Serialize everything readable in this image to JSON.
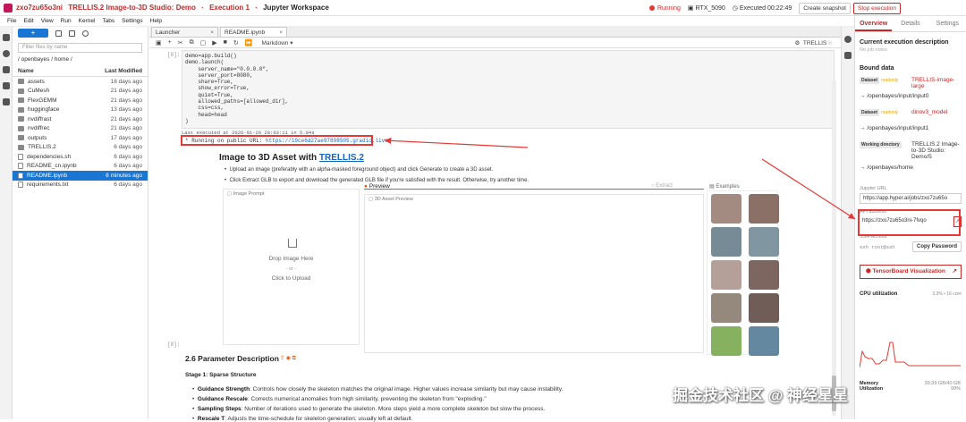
{
  "topbar": {
    "id": "zxo7zu65o3ni",
    "title": "TRELLIS.2 Image-to-3D Studio: Demo",
    "execution": "Execution 1",
    "workspace": "Jupyter Workspace",
    "status": "Running",
    "gpu": "RTX_5090",
    "executed_label": "Executed",
    "executed_time": "00:22:49",
    "create_snapshot": "Create snapshot",
    "stop_execution": "Stop execution"
  },
  "menu": [
    "File",
    "Edit",
    "View",
    "Run",
    "Kernel",
    "Tabs",
    "Settings",
    "Help"
  ],
  "filebrowser": {
    "new": "+",
    "filter_placeholder": "Filter files by name",
    "path": "/ openbayes / home /",
    "col_name": "Name",
    "col_modified": "Last Modified",
    "files": [
      {
        "name": "assets",
        "mod": "18 days ago",
        "type": "folder"
      },
      {
        "name": "CuMesh",
        "mod": "21 days ago",
        "type": "folder"
      },
      {
        "name": "FlexGEMM",
        "mod": "21 days ago",
        "type": "folder"
      },
      {
        "name": "huggingface",
        "mod": "13 days ago",
        "type": "folder"
      },
      {
        "name": "nvdiffrast",
        "mod": "21 days ago",
        "type": "folder"
      },
      {
        "name": "nvdiffrec",
        "mod": "21 days ago",
        "type": "folder"
      },
      {
        "name": "outputs",
        "mod": "17 days ago",
        "type": "folder"
      },
      {
        "name": "TRELLIS.2",
        "mod": "6 days ago",
        "type": "folder"
      },
      {
        "name": "dependencies.sh",
        "mod": "6 days ago",
        "type": "file"
      },
      {
        "name": "README_cn.ipynb",
        "mod": "6 days ago",
        "type": "file"
      },
      {
        "name": "README.ipynb",
        "mod": "8 minutes ago",
        "type": "file",
        "selected": true
      },
      {
        "name": "requirements.txt",
        "mod": "6 days ago",
        "type": "file"
      }
    ]
  },
  "tabs": [
    {
      "label": "Launcher"
    },
    {
      "label": "README.ipynb"
    }
  ],
  "notebook": {
    "cell_type": "Markdown",
    "kernel": "TRELLIS",
    "prompt1": "[8]:",
    "code_lines": [
      "demo=app.build()",
      "demo.launch(",
      "    server_name=\"0.0.0.0\",",
      "    server_port=8080,",
      "    share=True,",
      "    show_error=True,",
      "    quiet=True,",
      "    allowed_paths=[allowed_dir],",
      "    css=css,",
      "    head=head",
      ")"
    ],
    "last_exec": "Last executed at 2026-01-26 20:03:11 in 5.94s",
    "running": "* Running on public URL: ",
    "public_url": "https://19ce6d27ae97898505.gradio.live",
    "gradio_title": "Image to 3D Asset with ",
    "gradio_link": "TRELLIS.2",
    "bullet1": "Upload an image (preferably with an alpha-masked foreground object) and click Generate to create a 3D asset.",
    "bullet2": "Click Extract GLB to export and download the generated GLB file if you're satisfied with the result. Otherwise, try another time.",
    "image_prompt": "Image Prompt",
    "preview": "Preview",
    "extract": "Extract",
    "asset_preview": "3D Asset Preview",
    "examples": "Examples",
    "drop": "Drop Image Here",
    "or": "- or -",
    "click_upload": "Click to Upload",
    "prompt2": "[8]:",
    "md_title": "2.6 Parameter Description",
    "md_stage": "Stage 1: Sparse Structure",
    "md_items": [
      {
        "k": "Guidance Strength",
        "v": ": Controls how closely the skeleton matches the original image. Higher values increase similarity but may cause instability."
      },
      {
        "k": "Guidance Rescale",
        "v": ": Corrects numerical anomalies from high similarity, preventing the skeleton from \"exploding.\""
      },
      {
        "k": "Sampling Steps",
        "v": ": Number of iterations used to generate the skeleton. More steps yield a more complete skeleton but slow the process."
      },
      {
        "k": "Rescale T",
        "v": ": Adjusts the time-schedule for skeleton generation; usually left at default."
      }
    ]
  },
  "right": {
    "tabs": [
      "Overview",
      "Details",
      "Settings"
    ],
    "current_desc": "Current execution description",
    "no_notes": "No job notes",
    "bound": "Bound data",
    "datasets": [
      {
        "tag": "Dataset",
        "ro": "readonly",
        "name": "TRELLIS-image-large",
        "path": "/openbayes/input/input0"
      },
      {
        "tag": "Dataset",
        "ro": "readonly",
        "name": "dinov3_model",
        "path": "/openbayes/input/input1"
      },
      {
        "tag": "Working directory",
        "ro": "",
        "name": "TRELLIS.2 Image-to-3D Studio: Demo/5",
        "path": "/openbayes/home"
      }
    ],
    "jupyter_url_label": "Jupyter URL",
    "jupyter_url": "https://app.hyper.ai/jobs/zxo7zu65o",
    "api_label": "API address",
    "api": "https://zxo7zu65o3ni-7fvqo",
    "ssh_label": "SSH Access",
    "ssh": "ssh root@ssh",
    "copy_pw": "Copy Password",
    "tensorboard": "TensorBoard Visualization",
    "cpu_label": "CPU utilization",
    "cpu_value": "3.3% • 16 core",
    "memory": "Memory",
    "memory_value": "39.99 GB/40 GB",
    "utilization": "Utilization",
    "utilization_value": "99%"
  },
  "watermark": "掘金技术社区 @ 神经星星",
  "colors": {
    "accent": "#c62828",
    "link": "#1565c0",
    "highlight": "#e53935",
    "select": "#1976d2"
  }
}
